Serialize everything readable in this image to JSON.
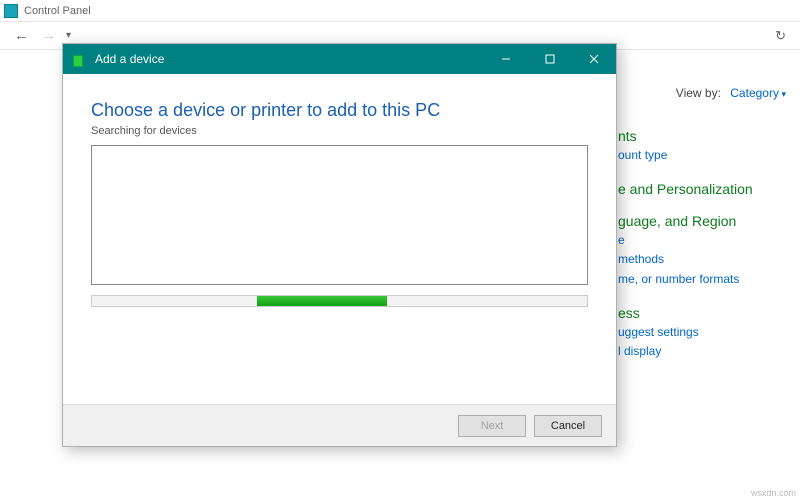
{
  "control_panel": {
    "window_title": "Control Panel",
    "viewby_label": "View by:",
    "viewby_value": "Category",
    "categories": [
      {
        "heading_fragment": "nts",
        "links": [
          "ount type"
        ]
      },
      {
        "heading_fragment": "e and Personalization",
        "links": []
      },
      {
        "heading_fragment": "guage, and Region",
        "links": [
          "e",
          "methods",
          "me, or number formats"
        ]
      },
      {
        "heading_fragment": "ess",
        "links": [
          "uggest settings",
          "l display"
        ]
      }
    ]
  },
  "dialog": {
    "title": "Add a device",
    "heading": "Choose a device or printer to add to this PC",
    "subtext": "Searching for devices",
    "buttons": {
      "next": "Next",
      "cancel": "Cancel"
    }
  },
  "watermark": "wsxdn.com"
}
